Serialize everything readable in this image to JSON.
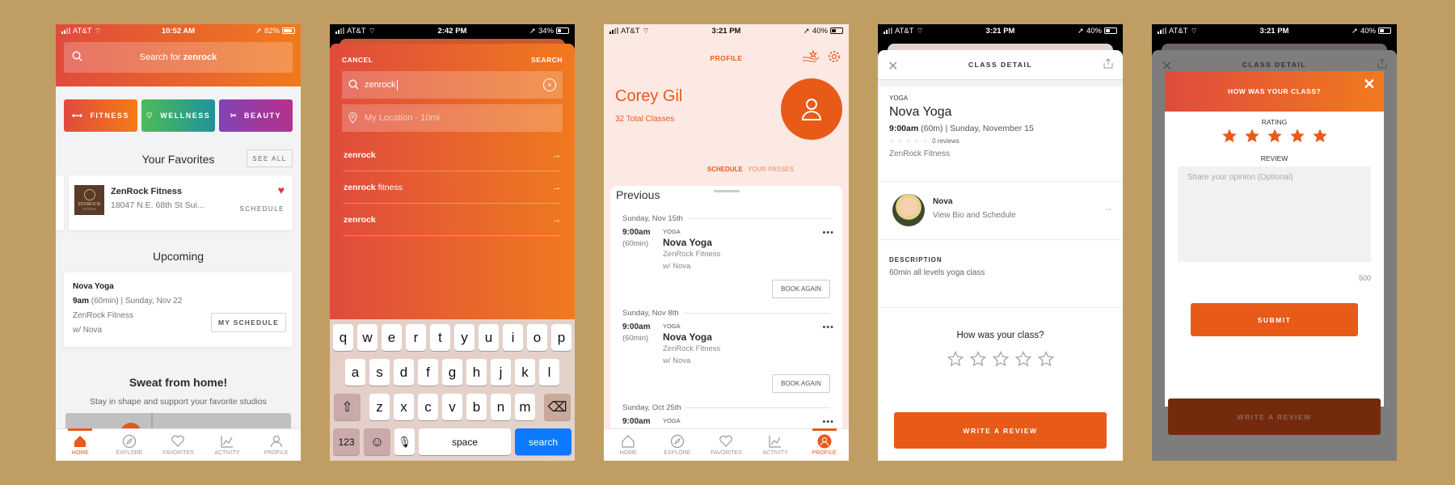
{
  "screens": {
    "home": {
      "status": {
        "carrier": "AT&T",
        "time": "10:52 AM",
        "battery": "82%"
      },
      "search": {
        "prefix": "Search for ",
        "term": "zenrock"
      },
      "categories": [
        {
          "label": "FITNESS",
          "icon": "dumbbell-icon"
        },
        {
          "label": "WELLNESS",
          "icon": "heart-pulse-icon"
        },
        {
          "label": "BEAUTY",
          "icon": "scissors-icon"
        }
      ],
      "favorites": {
        "title": "Your Favorites",
        "see_all": "SEE ALL",
        "item": {
          "logo_text": "ZENROCK",
          "logo_sub": "FITNESS",
          "name": "ZenRock Fitness",
          "address": "18047 N.E. 68th St Sui...",
          "action": "SCHEDULE",
          "favorited": true
        }
      },
      "upcoming": {
        "title": "Upcoming",
        "class_name": "Nova Yoga",
        "time": "9am",
        "detail": " (60min) | Sunday, Nov 22",
        "studio": "ZenRock Fitness",
        "instructor": "w/ Nova",
        "button": "MY SCHEDULE"
      },
      "promo": {
        "title": "Sweat from home!",
        "subtitle": "Stay in shape and support your favorite studios"
      }
    },
    "search": {
      "status": {
        "carrier": "AT&T",
        "time": "2:42 PM",
        "battery": "34%"
      },
      "cancel": "CANCEL",
      "search": "SEARCH",
      "query": "zenrock",
      "location_placeholder": "My Location - 10mi",
      "suggestions": [
        {
          "bold": "zenrock",
          "rest": ""
        },
        {
          "bold": "zenrock",
          "rest": " fitness"
        },
        {
          "bold": "zenrock",
          "rest": ""
        }
      ],
      "keyboard": {
        "row1": [
          "q",
          "w",
          "e",
          "r",
          "t",
          "y",
          "u",
          "i",
          "o",
          "p"
        ],
        "row2": [
          "a",
          "s",
          "d",
          "f",
          "g",
          "h",
          "j",
          "k",
          "l"
        ],
        "row3": [
          "z",
          "x",
          "c",
          "v",
          "b",
          "n",
          "m"
        ],
        "numbers": "123",
        "space": "space",
        "action": "search"
      }
    },
    "profile": {
      "status": {
        "carrier": "AT&T",
        "time": "3:21 PM",
        "battery": "40%"
      },
      "title": "PROFILE",
      "name": "Corey Gil",
      "total": "32 Total Classes",
      "tabs": [
        "SCHEDULE",
        "YOUR PASSES"
      ],
      "section": "Previous",
      "days": [
        {
          "date": "Sunday, Nov 15th",
          "time": "9:00am",
          "duration": "(60min)",
          "type": "YOGA",
          "name": "Nova Yoga",
          "studio": "ZenRock Fitness",
          "instructor": "w/ Nova",
          "button": "BOOK AGAIN"
        },
        {
          "date": "Sunday, Nov 8th",
          "time": "9:00am",
          "duration": "(60min)",
          "type": "YOGA",
          "name": "Nova Yoga",
          "studio": "ZenRock Fitness",
          "instructor": "w/ Nova",
          "button": "BOOK AGAIN"
        },
        {
          "date": "Sunday, Oct 25th",
          "time": "9:00am",
          "type": "YOGA"
        }
      ]
    },
    "class_detail": {
      "status": {
        "carrier": "AT&T",
        "time": "3:21 PM",
        "battery": "40%"
      },
      "title": "CLASS DETAIL",
      "type": "YOGA",
      "name": "Nova Yoga",
      "time": "9:00am",
      "detail": " (60m) | Sunday, November 15",
      "reviews": "0 reviews",
      "studio": "ZenRock Fitness",
      "instructor": {
        "name": "Nova",
        "link": "View Bio and Schedule"
      },
      "description_label": "DESCRIPTION",
      "description": "60min all levels yoga class",
      "rate_prompt": "How was your class?",
      "rating": 0,
      "write_review": "WRITE A REVIEW"
    },
    "review_modal": {
      "status": {
        "carrier": "AT&T",
        "time": "3:21 PM",
        "battery": "40%"
      },
      "bg_title": "CLASS DETAIL",
      "title": "HOW WAS YOUR CLASS?",
      "rating_label": "RATING",
      "rating": 5,
      "review_label": "REVIEW",
      "review_placeholder": "Share your opinion (Optional)",
      "char_count": "500",
      "submit": "SUBMIT",
      "bg_button": "WRITE A REVIEW"
    }
  },
  "tabbar": [
    "HOME",
    "EXPLORE",
    "FAVORITES",
    "ACTIVITY",
    "PROFILE"
  ],
  "colors": {
    "accent": "#e85a18",
    "background": "#c09e63",
    "keyboard_action": "#0a7afe",
    "heart": "#d93a48"
  }
}
